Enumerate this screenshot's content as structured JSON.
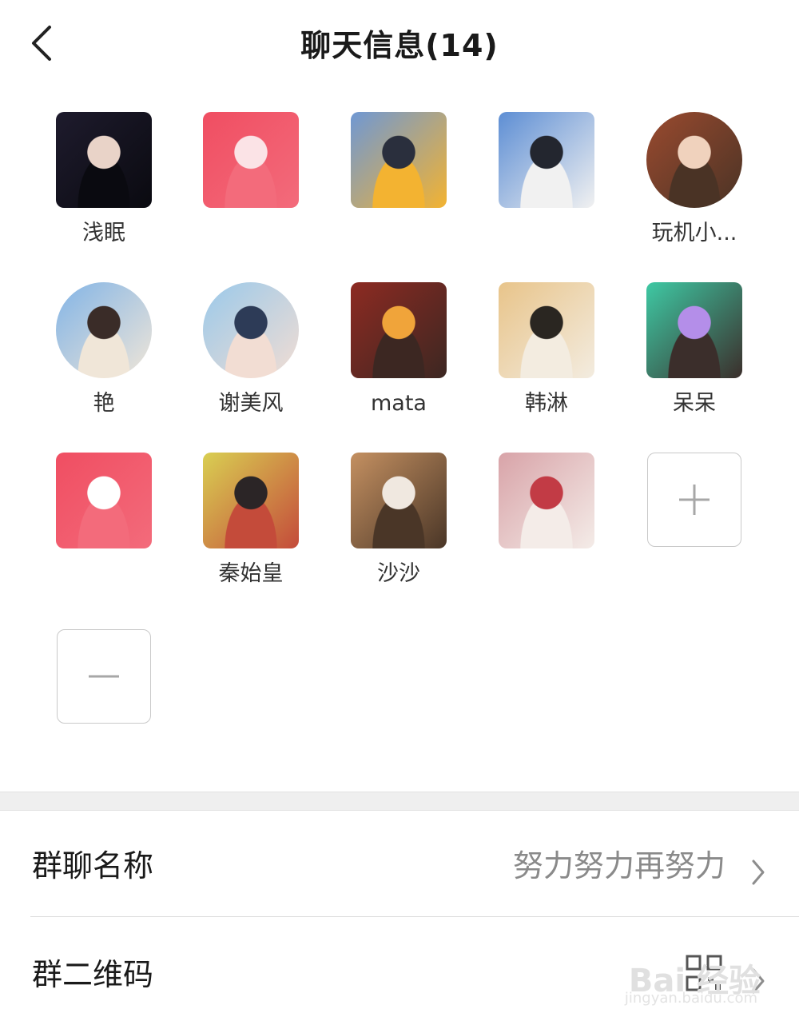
{
  "header": {
    "title": "聊天信息(14)",
    "back_icon": "back-chevron-icon"
  },
  "members": [
    {
      "name": "浅眠",
      "shape": "square",
      "colors": [
        "#1e1b2d",
        "#e9d3c8",
        "#0a0a10"
      ]
    },
    {
      "name": "",
      "shape": "square",
      "colors": [
        "#f04e62",
        "#fbe3e6",
        "#f36b7b"
      ]
    },
    {
      "name": "",
      "shape": "square",
      "colors": [
        "#6f98d4",
        "#2a2f3d",
        "#f3b331"
      ]
    },
    {
      "name": "",
      "shape": "square",
      "colors": [
        "#5d8ed4",
        "#23262f",
        "#f1f1f1"
      ]
    },
    {
      "name": "玩机小...",
      "shape": "round",
      "colors": [
        "#9a4a2f",
        "#f0d2bd",
        "#4a3325"
      ]
    },
    {
      "name": "艳",
      "shape": "round",
      "colors": [
        "#82b4e6",
        "#3a2c28",
        "#f0e6d8"
      ]
    },
    {
      "name": "谢美风",
      "shape": "round",
      "colors": [
        "#9ac9ea",
        "#2d3b57",
        "#f2ddd3"
      ]
    },
    {
      "name": "mata",
      "shape": "square",
      "colors": [
        "#8d2a22",
        "#f0a43a",
        "#3c2722"
      ]
    },
    {
      "name": "韩淋",
      "shape": "square",
      "colors": [
        "#e8c48a",
        "#2a2621",
        "#f3ece0"
      ]
    },
    {
      "name": "呆呆",
      "shape": "square",
      "colors": [
        "#3ec9a4",
        "#b48ee9",
        "#3b2e2b"
      ]
    },
    {
      "name": "",
      "shape": "square",
      "colors": [
        "#f04e62",
        "#ffffff",
        "#f36b7b"
      ]
    },
    {
      "name": "秦始皇",
      "shape": "square",
      "colors": [
        "#d9cf52",
        "#2b2526",
        "#c44b3a"
      ]
    },
    {
      "name": "沙沙",
      "shape": "square",
      "colors": [
        "#c49061",
        "#f0e8e0",
        "#4a3627"
      ]
    },
    {
      "name": "",
      "shape": "square",
      "colors": [
        "#d8a3a8",
        "#c23b45",
        "#f4ece8"
      ]
    }
  ],
  "add_tile": {
    "icon": "plus-icon"
  },
  "remove_tile": {
    "icon": "minus-icon"
  },
  "settings": {
    "group_name": {
      "label": "群聊名称",
      "value": "努力努力再努力"
    },
    "group_qr": {
      "label": "群二维码"
    }
  },
  "watermark": {
    "main": "Bai 经验",
    "sub": "jingyan.baidu.com"
  }
}
